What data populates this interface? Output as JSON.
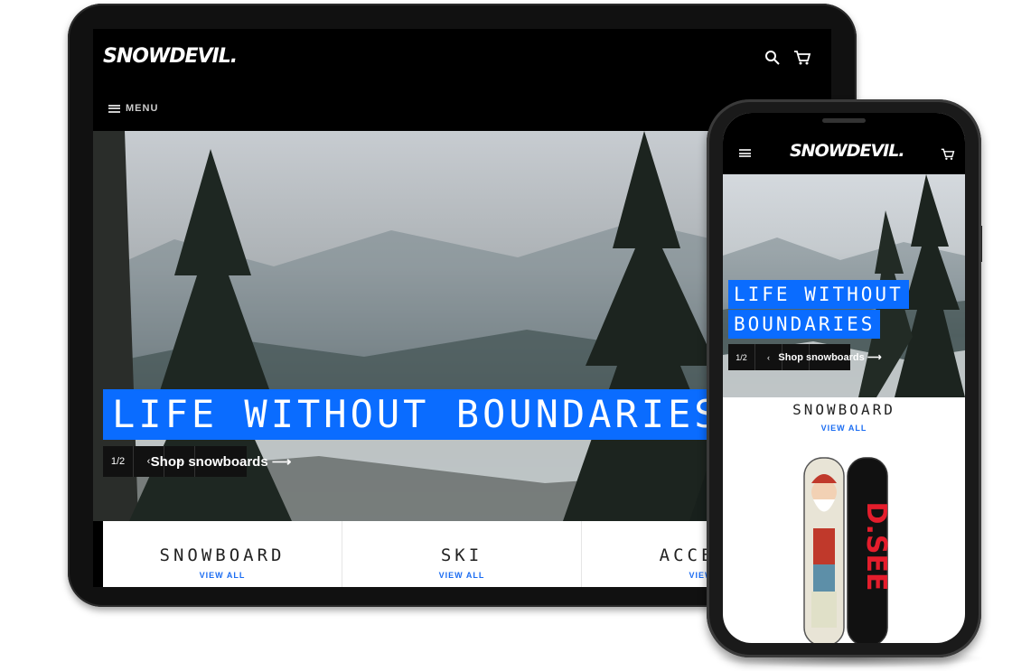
{
  "brand": {
    "logo": "SNOWDEVIL."
  },
  "tablet": {
    "menu_label": "MENU",
    "hero": {
      "headline": "LIFE WITHOUT BOUNDARIES",
      "slide_counter": "1/2",
      "prev_icon": "‹",
      "next_icon": "›",
      "cta": "Shop snowboards ⟶"
    },
    "categories": [
      {
        "title": "SNOWBOARD",
        "link": "VIEW ALL"
      },
      {
        "title": "SKI",
        "link": "VIEW ALL"
      },
      {
        "title": "ACCESS",
        "link": "VIEW"
      }
    ]
  },
  "phone": {
    "hero": {
      "headline_line1": "LIFE WITHOUT",
      "headline_line2": "BOUNDARIES",
      "slide_counter": "1/2",
      "prev_icon": "‹",
      "next_icon": "›",
      "cta": "Shop snowboards ⟶"
    },
    "category": {
      "title": "SNOWBOARD",
      "link": "VIEW ALL"
    },
    "board_text": "D.SEE"
  },
  "colors": {
    "accent": "#0a6cff",
    "link": "#1a6cf2",
    "header_bg": "#000000"
  },
  "icons": [
    "search-icon",
    "cart-icon",
    "menu-icon",
    "chevron-left-icon",
    "chevron-right-icon"
  ]
}
